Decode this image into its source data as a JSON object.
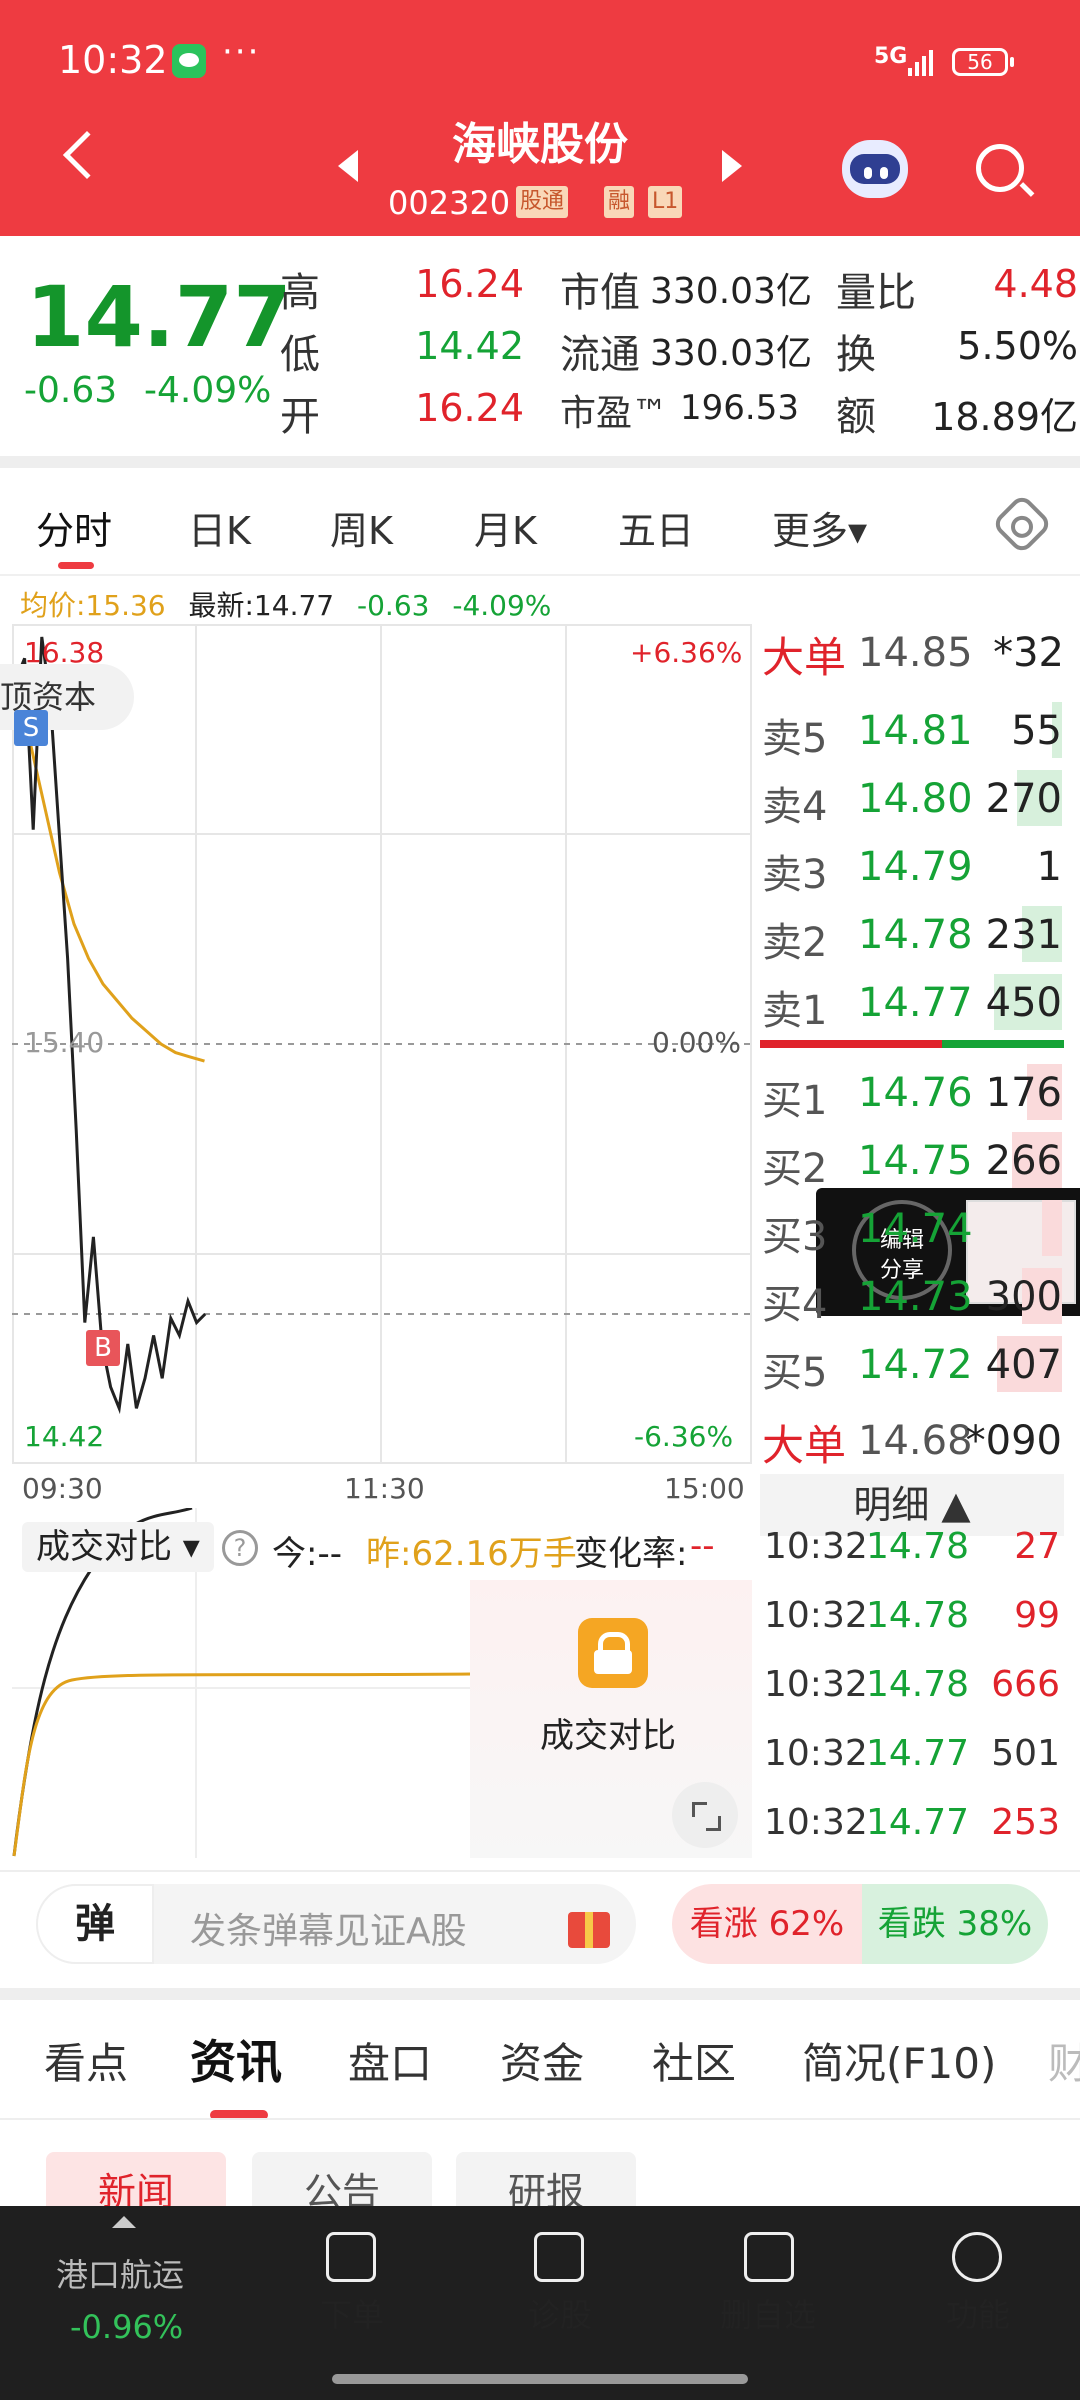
{
  "status": {
    "time": "10:32",
    "dots": "···",
    "network": "5G",
    "battery": "56"
  },
  "header": {
    "stock_name": "海峡股份",
    "stock_code": "002320",
    "tag_sgt": "股通",
    "tag_rong": "融",
    "tag_level": "L1"
  },
  "quote": {
    "price": "14.77",
    "change": "-0.63",
    "change_pct": "-4.09%",
    "high_label": "高",
    "high": "16.24",
    "low_label": "低",
    "low": "14.42",
    "open_label": "开",
    "open": "16.24",
    "mktcap_label": "市值",
    "mktcap": "330.03亿",
    "float_label": "流通",
    "float": "330.03亿",
    "pe_label": "市盈™",
    "pe": "196.53",
    "volratio_label": "量比",
    "volratio": "4.48",
    "turnover_label": "换",
    "turnover": "5.50%",
    "amount_label": "额",
    "amount": "18.89亿"
  },
  "tabs": [
    "分时",
    "日K",
    "周K",
    "月K",
    "五日",
    "更多▾"
  ],
  "chart_legend": {
    "avg_label": "均价:15.36",
    "last_label": "最新:14.77",
    "chg": "-0.63",
    "chg_pct": "-4.09%"
  },
  "chart_data": {
    "type": "line",
    "x_ticks": [
      "09:30",
      "11:30",
      "15:00"
    ],
    "y_top_label": "16.38",
    "y_mid_label": "15.40",
    "y_bottom_label": "14.42",
    "pct_top": "+6.36%",
    "pct_mid": "0.00%",
    "pct_bottom": "-6.36%",
    "ylim": [
      14.42,
      16.38
    ],
    "series": [
      {
        "color": "#222222",
        "values": [
          16.25,
          16.3,
          15.9,
          16.35,
          16.2,
          15.9,
          15.6,
          15.2,
          14.75,
          14.95,
          14.7,
          14.6,
          14.55,
          14.7,
          14.55,
          14.62,
          14.72,
          14.62,
          14.76,
          14.72,
          14.8,
          14.75,
          14.77
        ]
      },
      {
        "color": "#e0a11b",
        "values": [
          16.2,
          16.1,
          15.95,
          15.8,
          15.68,
          15.6,
          15.54,
          15.5,
          15.46,
          15.43,
          15.4,
          15.38,
          15.37,
          15.36
        ]
      }
    ],
    "markers": [
      "S",
      "B"
    ],
    "left_overlay": "顶资本"
  },
  "orderbook": {
    "big_sell": {
      "label": "大单",
      "price": "14.85",
      "vol": "*32"
    },
    "asks": [
      {
        "label": "卖5",
        "price": "14.81",
        "vol": "55",
        "fill": 0.1
      },
      {
        "label": "卖4",
        "price": "14.80",
        "vol": "270",
        "fill": 0.45
      },
      {
        "label": "卖3",
        "price": "14.79",
        "vol": "1",
        "fill": 0.0
      },
      {
        "label": "卖2",
        "price": "14.78",
        "vol": "231",
        "fill": 0.4
      },
      {
        "label": "卖1",
        "price": "14.77",
        "vol": "450",
        "fill": 0.68
      }
    ],
    "bids": [
      {
        "label": "买1",
        "price": "14.76",
        "vol": "176",
        "fill": 0.35
      },
      {
        "label": "买2",
        "price": "14.75",
        "vol": "266",
        "fill": 0.5
      },
      {
        "label": "买3",
        "price": "14.74",
        "vol": "",
        "fill": 0.2
      },
      {
        "label": "买4",
        "price": "14.73",
        "vol": "300",
        "fill": 0.4
      },
      {
        "label": "买5",
        "price": "14.72",
        "vol": "407",
        "fill": 0.65
      }
    ],
    "big_buy": {
      "label": "大单",
      "price": "14.68",
      "vol": "*090"
    },
    "detail_label": "明细 ▲"
  },
  "ticks": [
    {
      "time": "10:32",
      "price": "14.78",
      "vol": "27"
    },
    {
      "time": "10:32",
      "price": "14.78",
      "vol": "99"
    },
    {
      "time": "10:32",
      "price": "14.78",
      "vol": "666"
    },
    {
      "time": "10:32",
      "price": "14.77",
      "vol": "501"
    },
    {
      "time": "10:32",
      "price": "14.77",
      "vol": "253"
    }
  ],
  "float_card": {
    "line1": "编辑",
    "line2": "分享"
  },
  "compare": {
    "title": "成交对比 ▾",
    "help": "?",
    "today": "今:--",
    "yesterday": "昨:62.16万手",
    "rate_label": "变化率:",
    "rate": "--",
    "lock_label": "成交对比"
  },
  "danmaku": {
    "icon_text": "弹",
    "placeholder": "发条弹幕见证A股",
    "vote_up": "看涨 62%",
    "vote_down": "看跌 38%"
  },
  "sections": [
    "看点",
    "资讯",
    "盘口",
    "资金",
    "社区",
    "简况(F10)",
    "财"
  ],
  "sub_tabs": [
    "新闻",
    "公告",
    "研报"
  ],
  "bottom_nav": {
    "sector_name": "港口航运",
    "sector_chg": "-0.96%",
    "items": [
      "下单",
      "诊股",
      "删自选",
      "功能"
    ]
  }
}
